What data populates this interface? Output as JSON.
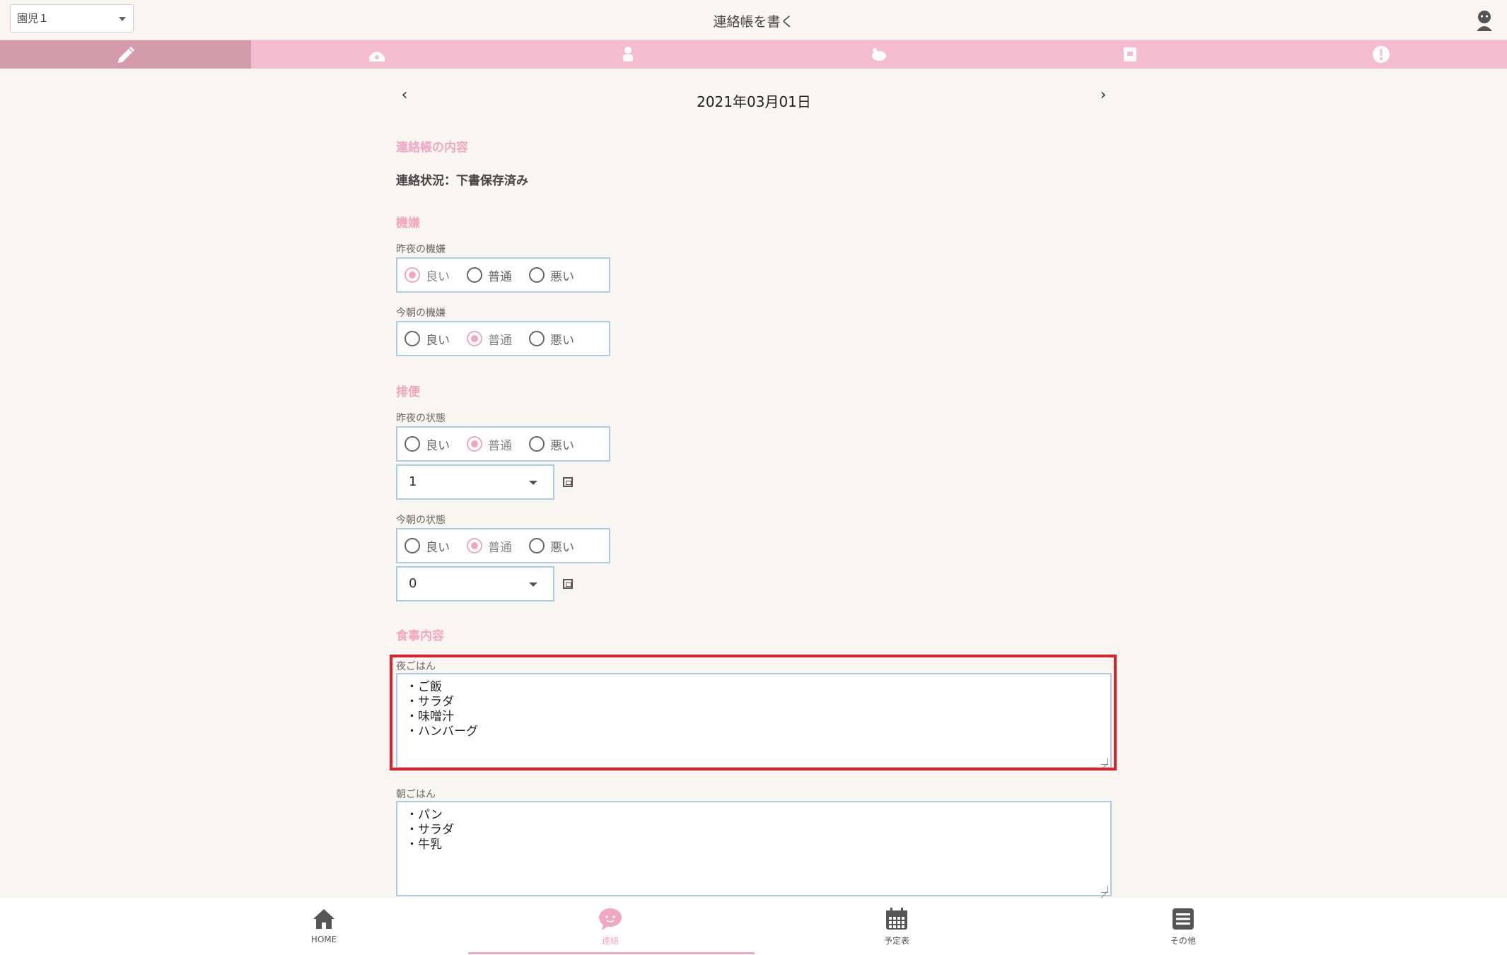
{
  "header": {
    "child_select": "園児１",
    "title": "連絡帳を書く"
  },
  "tabs": [
    {
      "name": "write-tab",
      "icon": "pencil-icon",
      "active": true
    },
    {
      "name": "diary-tab",
      "icon": "telephone-icon",
      "active": false
    },
    {
      "name": "meal-tab",
      "icon": "child-icon",
      "active": false
    },
    {
      "name": "play-tab",
      "icon": "turtle-icon",
      "active": false
    },
    {
      "name": "photo-tab",
      "icon": "card-icon",
      "active": false
    },
    {
      "name": "alert-tab",
      "icon": "exclamation-icon",
      "active": false
    }
  ],
  "date": {
    "prev": "‹",
    "text": "2021年03月01日",
    "next": "›"
  },
  "contents": {
    "section_title": "連絡帳の内容",
    "status": "連絡状況：下書保存済み"
  },
  "mood": {
    "section_title": "機嫌",
    "last_night_label": "昨夜の機嫌",
    "this_morning_label": "今朝の機嫌",
    "options": [
      "良い",
      "普通",
      "悪い"
    ],
    "last_night_selected": "良い",
    "this_morning_selected": "普通"
  },
  "stool": {
    "section_title": "排便",
    "last_night_label": "昨夜の状態",
    "this_morning_label": "今朝の状態",
    "last_night_selected": "普通",
    "this_morning_selected": "普通",
    "last_night_count": "1",
    "this_morning_count": "0"
  },
  "meals": {
    "section_title": "食事内容",
    "dinner_label": "夜ごはん",
    "dinner_lines": [
      "・ご飯",
      "・サラダ",
      "・味噌汁",
      "・ハンバーグ"
    ],
    "breakfast_label": "朝ごはん",
    "breakfast_lines": [
      "・パン",
      "・サラダ",
      "・牛乳"
    ]
  },
  "bottom_nav": {
    "home": "HOME",
    "contact": "連絡",
    "schedule": "予定表",
    "other": "その他"
  },
  "colors": {
    "accent_pink": "#f1a7c0",
    "tab_bar": "#f5bccf",
    "tab_active": "#d39bab",
    "field_border": "#a9cde4",
    "highlight_red": "#e0202a",
    "background": "#f9f6f2"
  }
}
